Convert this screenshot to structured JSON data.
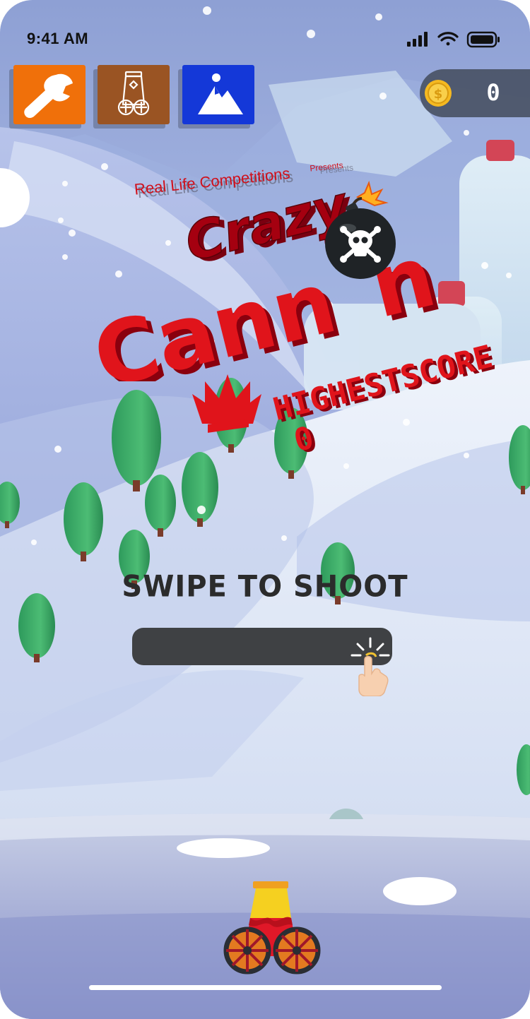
{
  "status_bar": {
    "time": "9:41 AM"
  },
  "toolbar": {
    "buttons": [
      {
        "name": "settings-button",
        "icon": "wrench-icon",
        "color": "#f0700a"
      },
      {
        "name": "cannon-select-button",
        "icon": "cannon-icon",
        "color": "#9a5423"
      },
      {
        "name": "scene-select-button",
        "icon": "mountain-icon",
        "color": "#1438d8"
      }
    ]
  },
  "coins": {
    "icon": "coin-icon",
    "value": "0"
  },
  "logo": {
    "presenter": "Real Life Competitions",
    "presents": "Presents",
    "line1": "Crazy",
    "line2_before_bomb": "Cann",
    "line2_after_bomb": "n",
    "bomb_icon": "skull-bomb-icon"
  },
  "highscore": {
    "label": "HIGHESTSCORE",
    "value": "0",
    "icon": "crown-icon"
  },
  "instructions": {
    "label": "SWIPE TO SHOOT",
    "hand_icon": "tap-hand-icon"
  },
  "colors": {
    "title_red": "#e0141b",
    "title_dark_red": "#a50010",
    "track": "#3f4144",
    "coin_gold": "#f5b921"
  }
}
